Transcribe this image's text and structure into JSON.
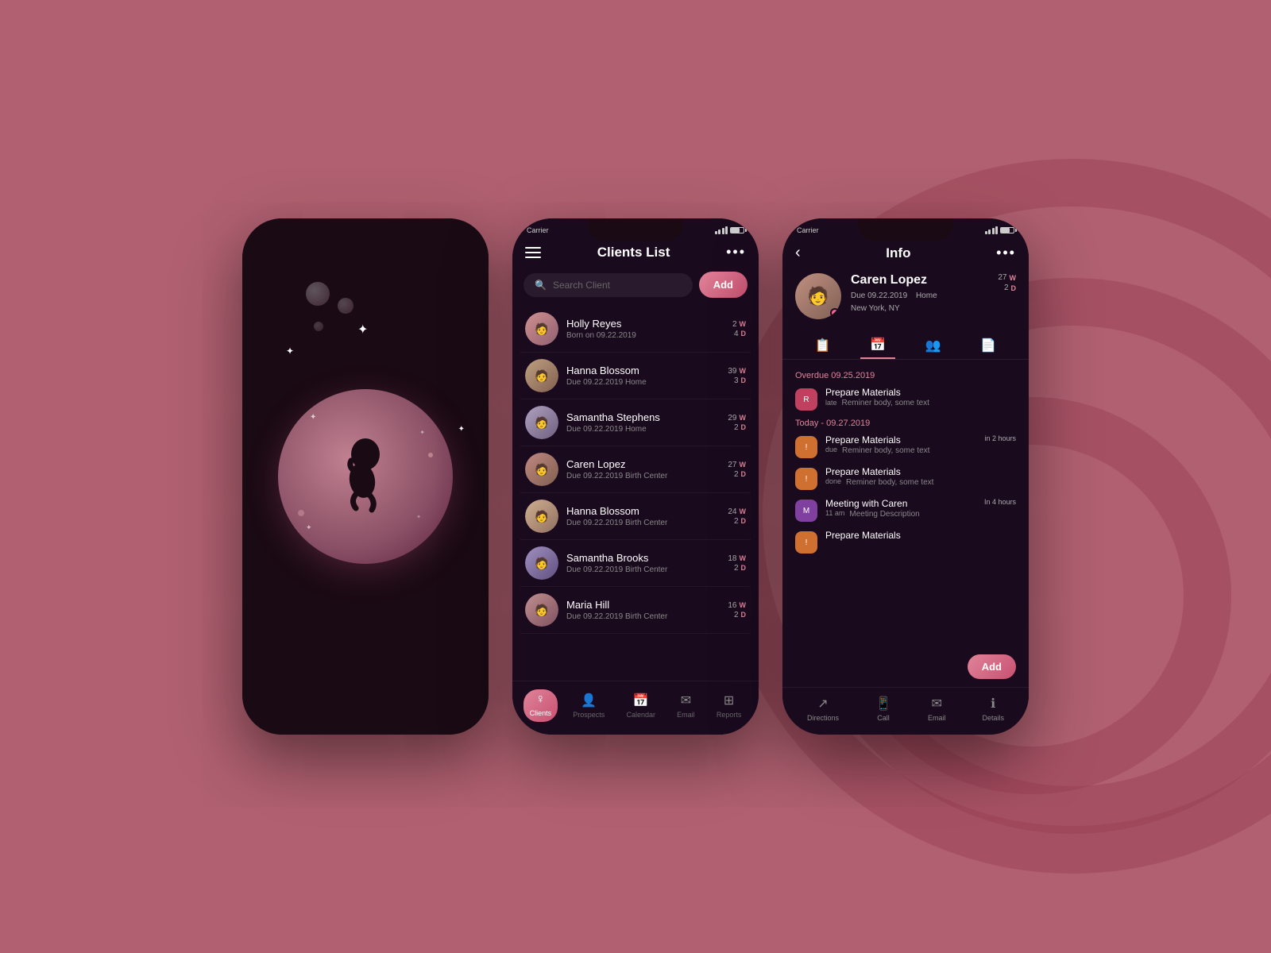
{
  "background": {
    "color": "#b06070"
  },
  "phone1": {
    "type": "splash"
  },
  "phone2": {
    "status_bar": {
      "carrier": "Carrier",
      "battery": "■■■"
    },
    "header": {
      "title": "Clients List",
      "menu_dots": "•••"
    },
    "search": {
      "placeholder": "Search Client",
      "add_button": "Add"
    },
    "clients": [
      {
        "name": "Holly Reyes",
        "detail": "Born on  09.22.2019",
        "w": "2",
        "d": "4",
        "avatar": "👩"
      },
      {
        "name": "Hanna Blossom",
        "detail": "Due 09.22.2019   Home",
        "w": "39",
        "d": "3",
        "avatar": "👩"
      },
      {
        "name": "Samantha Stephens",
        "detail": "Due 09.22.2019   Home",
        "w": "29",
        "d": "2",
        "avatar": "👩"
      },
      {
        "name": "Caren Lopez",
        "detail": "Due 09.22.2019   Birth Center",
        "w": "27",
        "d": "2",
        "avatar": "👩"
      },
      {
        "name": "Hanna Blossom",
        "detail": "Due 09.22.2019   Birth Center",
        "w": "24",
        "d": "2",
        "avatar": "👩"
      },
      {
        "name": "Samantha Brooks",
        "detail": "Due 09.22.2019   Birth Center",
        "w": "18",
        "d": "2",
        "avatar": "👩"
      },
      {
        "name": "Maria Hill",
        "detail": "Due 09.22.2019   Birth Center",
        "w": "16",
        "d": "2",
        "avatar": "👩"
      }
    ],
    "bottom_nav": [
      {
        "label": "Clients",
        "icon": "♀",
        "active": true
      },
      {
        "label": "Prospects",
        "icon": "👤",
        "active": false
      },
      {
        "label": "Calendar",
        "icon": "📅",
        "active": false
      },
      {
        "label": "Email",
        "icon": "✉",
        "active": false
      },
      {
        "label": "Reports",
        "icon": "⊞",
        "active": false
      }
    ]
  },
  "phone3": {
    "status_bar": {
      "carrier": "Carrier"
    },
    "header": {
      "back": "‹",
      "title": "Info",
      "menu_dots": "•••"
    },
    "client": {
      "name": "Caren Lopez",
      "due": "Due 09.22.2019",
      "location_type": "Home",
      "location": "New York, NY",
      "w": "27",
      "d": "2",
      "w_label": "W",
      "d_label": "D"
    },
    "tabs": [
      {
        "icon": "📋",
        "active": false
      },
      {
        "icon": "📅",
        "active": true
      },
      {
        "icon": "👥",
        "active": false
      },
      {
        "icon": "📄",
        "active": false
      }
    ],
    "overdue_section": {
      "date": "Overdue 09.25.2019",
      "tasks": [
        {
          "title": "Prepare Materials",
          "status": "late",
          "sub": "Reminer body, some text",
          "time": "",
          "color": "red"
        }
      ]
    },
    "today_section": {
      "date": "Today - 09.27.2019",
      "tasks": [
        {
          "title": "Prepare Materials",
          "status": "due",
          "sub": "Reminer body, some text",
          "time": "in 2 hours",
          "color": "orange"
        },
        {
          "title": "Prepare Materials",
          "status": "done",
          "sub": "Reminer body, some text",
          "time": "",
          "color": "orange"
        },
        {
          "title": "Meeting with Caren",
          "status": "11 am",
          "sub": "Meeting Description",
          "time": "In 4 hours",
          "color": "purple"
        },
        {
          "title": "Prepare Materials",
          "status": "",
          "sub": "",
          "time": "",
          "color": "orange"
        }
      ]
    },
    "add_button": "Add",
    "action_bar": [
      {
        "label": "Directions",
        "icon": "↗"
      },
      {
        "label": "Call",
        "icon": "📱"
      },
      {
        "label": "Email",
        "icon": "✉"
      },
      {
        "label": "Details",
        "icon": "ℹ"
      }
    ]
  }
}
